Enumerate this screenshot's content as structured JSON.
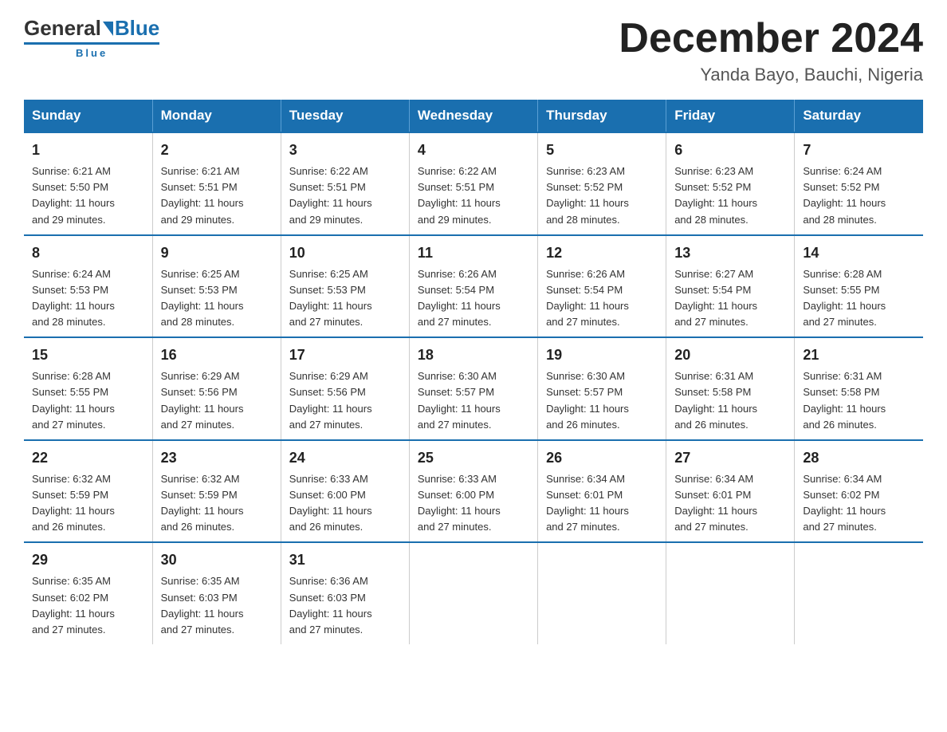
{
  "logo": {
    "general": "General",
    "blue": "Blue",
    "subtitle": "Blue"
  },
  "title": "December 2024",
  "subtitle": "Yanda Bayo, Bauchi, Nigeria",
  "days_of_week": [
    "Sunday",
    "Monday",
    "Tuesday",
    "Wednesday",
    "Thursday",
    "Friday",
    "Saturday"
  ],
  "weeks": [
    [
      {
        "day": "1",
        "info": "Sunrise: 6:21 AM\nSunset: 5:50 PM\nDaylight: 11 hours\nand 29 minutes."
      },
      {
        "day": "2",
        "info": "Sunrise: 6:21 AM\nSunset: 5:51 PM\nDaylight: 11 hours\nand 29 minutes."
      },
      {
        "day": "3",
        "info": "Sunrise: 6:22 AM\nSunset: 5:51 PM\nDaylight: 11 hours\nand 29 minutes."
      },
      {
        "day": "4",
        "info": "Sunrise: 6:22 AM\nSunset: 5:51 PM\nDaylight: 11 hours\nand 29 minutes."
      },
      {
        "day": "5",
        "info": "Sunrise: 6:23 AM\nSunset: 5:52 PM\nDaylight: 11 hours\nand 28 minutes."
      },
      {
        "day": "6",
        "info": "Sunrise: 6:23 AM\nSunset: 5:52 PM\nDaylight: 11 hours\nand 28 minutes."
      },
      {
        "day": "7",
        "info": "Sunrise: 6:24 AM\nSunset: 5:52 PM\nDaylight: 11 hours\nand 28 minutes."
      }
    ],
    [
      {
        "day": "8",
        "info": "Sunrise: 6:24 AM\nSunset: 5:53 PM\nDaylight: 11 hours\nand 28 minutes."
      },
      {
        "day": "9",
        "info": "Sunrise: 6:25 AM\nSunset: 5:53 PM\nDaylight: 11 hours\nand 28 minutes."
      },
      {
        "day": "10",
        "info": "Sunrise: 6:25 AM\nSunset: 5:53 PM\nDaylight: 11 hours\nand 27 minutes."
      },
      {
        "day": "11",
        "info": "Sunrise: 6:26 AM\nSunset: 5:54 PM\nDaylight: 11 hours\nand 27 minutes."
      },
      {
        "day": "12",
        "info": "Sunrise: 6:26 AM\nSunset: 5:54 PM\nDaylight: 11 hours\nand 27 minutes."
      },
      {
        "day": "13",
        "info": "Sunrise: 6:27 AM\nSunset: 5:54 PM\nDaylight: 11 hours\nand 27 minutes."
      },
      {
        "day": "14",
        "info": "Sunrise: 6:28 AM\nSunset: 5:55 PM\nDaylight: 11 hours\nand 27 minutes."
      }
    ],
    [
      {
        "day": "15",
        "info": "Sunrise: 6:28 AM\nSunset: 5:55 PM\nDaylight: 11 hours\nand 27 minutes."
      },
      {
        "day": "16",
        "info": "Sunrise: 6:29 AM\nSunset: 5:56 PM\nDaylight: 11 hours\nand 27 minutes."
      },
      {
        "day": "17",
        "info": "Sunrise: 6:29 AM\nSunset: 5:56 PM\nDaylight: 11 hours\nand 27 minutes."
      },
      {
        "day": "18",
        "info": "Sunrise: 6:30 AM\nSunset: 5:57 PM\nDaylight: 11 hours\nand 27 minutes."
      },
      {
        "day": "19",
        "info": "Sunrise: 6:30 AM\nSunset: 5:57 PM\nDaylight: 11 hours\nand 26 minutes."
      },
      {
        "day": "20",
        "info": "Sunrise: 6:31 AM\nSunset: 5:58 PM\nDaylight: 11 hours\nand 26 minutes."
      },
      {
        "day": "21",
        "info": "Sunrise: 6:31 AM\nSunset: 5:58 PM\nDaylight: 11 hours\nand 26 minutes."
      }
    ],
    [
      {
        "day": "22",
        "info": "Sunrise: 6:32 AM\nSunset: 5:59 PM\nDaylight: 11 hours\nand 26 minutes."
      },
      {
        "day": "23",
        "info": "Sunrise: 6:32 AM\nSunset: 5:59 PM\nDaylight: 11 hours\nand 26 minutes."
      },
      {
        "day": "24",
        "info": "Sunrise: 6:33 AM\nSunset: 6:00 PM\nDaylight: 11 hours\nand 26 minutes."
      },
      {
        "day": "25",
        "info": "Sunrise: 6:33 AM\nSunset: 6:00 PM\nDaylight: 11 hours\nand 27 minutes."
      },
      {
        "day": "26",
        "info": "Sunrise: 6:34 AM\nSunset: 6:01 PM\nDaylight: 11 hours\nand 27 minutes."
      },
      {
        "day": "27",
        "info": "Sunrise: 6:34 AM\nSunset: 6:01 PM\nDaylight: 11 hours\nand 27 minutes."
      },
      {
        "day": "28",
        "info": "Sunrise: 6:34 AM\nSunset: 6:02 PM\nDaylight: 11 hours\nand 27 minutes."
      }
    ],
    [
      {
        "day": "29",
        "info": "Sunrise: 6:35 AM\nSunset: 6:02 PM\nDaylight: 11 hours\nand 27 minutes."
      },
      {
        "day": "30",
        "info": "Sunrise: 6:35 AM\nSunset: 6:03 PM\nDaylight: 11 hours\nand 27 minutes."
      },
      {
        "day": "31",
        "info": "Sunrise: 6:36 AM\nSunset: 6:03 PM\nDaylight: 11 hours\nand 27 minutes."
      },
      {
        "day": "",
        "info": ""
      },
      {
        "day": "",
        "info": ""
      },
      {
        "day": "",
        "info": ""
      },
      {
        "day": "",
        "info": ""
      }
    ]
  ]
}
